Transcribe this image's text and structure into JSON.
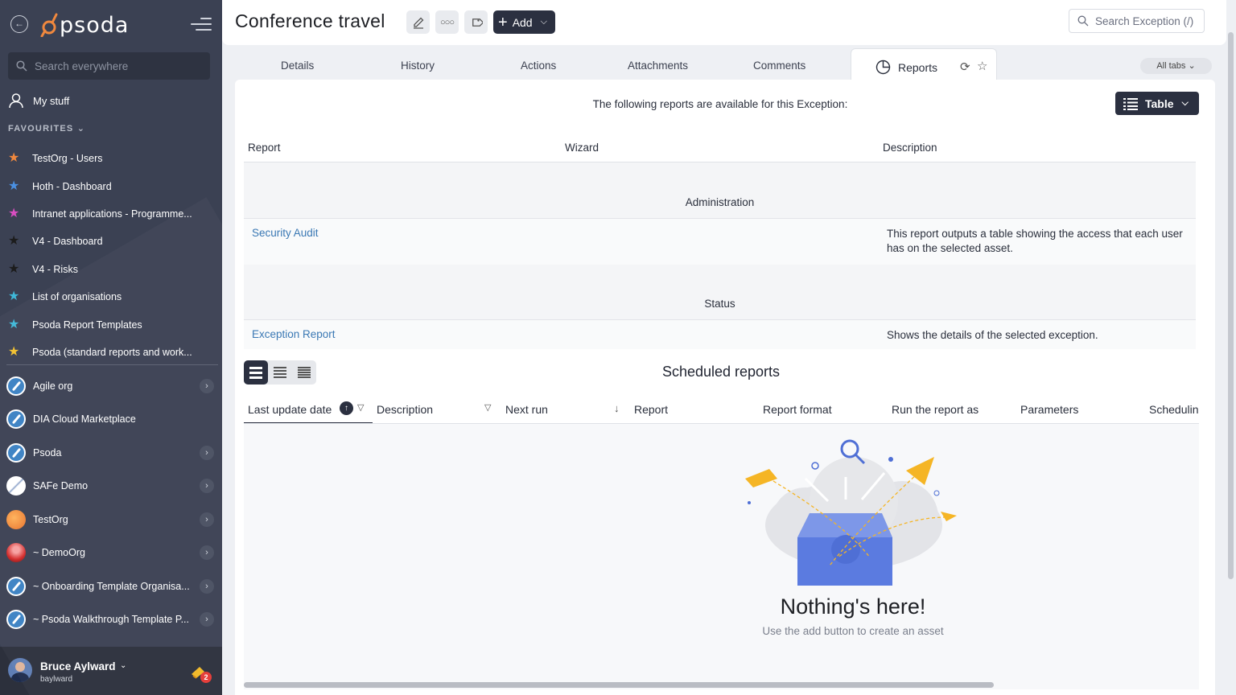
{
  "sidebar": {
    "logo": "psoda",
    "search_placeholder": "Search everywhere",
    "my_stuff": "My stuff",
    "favourites_label": "FAVOURITES",
    "favourites": [
      {
        "label": "TestOrg - Users",
        "color": "#f0883e"
      },
      {
        "label": "Hoth - Dashboard",
        "color": "#4a90e2"
      },
      {
        "label": "Intranet applications - Programme...",
        "color": "#d94ec1"
      },
      {
        "label": "V4 - Dashboard",
        "color": "#2b2b2b"
      },
      {
        "label": "V4 - Risks",
        "color": "#2b2b2b"
      },
      {
        "label": "List of organisations",
        "color": "#3fb8d8"
      },
      {
        "label": "Psoda Report Templates",
        "color": "#3fb8d8"
      },
      {
        "label": "Psoda (standard reports and work...",
        "color": "#f2c12e"
      }
    ],
    "orgs": [
      {
        "label": "Agile org",
        "avatar": "compass",
        "chevron": true
      },
      {
        "label": "DIA Cloud Marketplace",
        "avatar": "compass",
        "chevron": false
      },
      {
        "label": "Psoda",
        "avatar": "compass",
        "chevron": true
      },
      {
        "label": "SAFe Demo",
        "avatar": "safe",
        "chevron": true
      },
      {
        "label": "TestOrg",
        "avatar": "orange",
        "chevron": true
      },
      {
        "label": "~ DemoOrg",
        "avatar": "red",
        "chevron": true
      },
      {
        "label": "~ Onboarding Template Organisa...",
        "avatar": "compass",
        "chevron": true
      },
      {
        "label": "~ Psoda Walkthrough Template P...",
        "avatar": "compass",
        "chevron": true
      }
    ],
    "user": {
      "name": "Bruce Aylward",
      "username": "baylward",
      "notifications": "2"
    }
  },
  "header": {
    "title": "Conference travel",
    "add_label": "Add",
    "search_placeholder": "Search Exception (/)"
  },
  "tabs": {
    "items": [
      "Details",
      "History",
      "Actions",
      "Attachments",
      "Comments"
    ],
    "active": "Reports",
    "all_tabs": "All tabs"
  },
  "reports": {
    "intro": "The following reports are available for this Exception:",
    "view_label": "Table",
    "columns": [
      "Report",
      "Wizard",
      "Description"
    ],
    "groups": [
      {
        "name": "Administration",
        "reports": [
          {
            "name": "Security Audit",
            "description": "This report outputs a table showing the access that each user has on the selected asset."
          }
        ]
      },
      {
        "name": "Status",
        "reports": [
          {
            "name": "Exception Report",
            "description": "Shows the details of the selected exception."
          }
        ]
      }
    ]
  },
  "scheduled": {
    "title": "Scheduled reports",
    "columns": [
      "Last update date",
      "Description",
      "Next run",
      "Report",
      "Report format",
      "Run the report as",
      "Parameters",
      "Schedulin"
    ],
    "empty_title": "Nothing's here!",
    "empty_sub": "Use the add button to create an asset"
  }
}
